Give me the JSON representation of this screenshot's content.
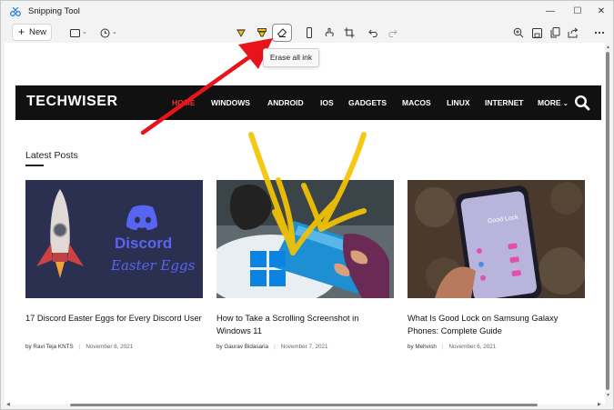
{
  "window": {
    "title": "Snipping Tool",
    "minimize_glyph": "—",
    "maximize_glyph": "☐",
    "close_glyph": "✕"
  },
  "toolbar": {
    "new_label": "New",
    "new_icon": "plus-icon",
    "tooltip": "Erase all ink",
    "icons": [
      "snip-mode-icon",
      "delay-timer-icon",
      "ballpoint-pen-icon",
      "highlighter-icon",
      "eraser-icon",
      "ruler-icon",
      "touch-writing-icon",
      "crop-icon",
      "undo-icon",
      "redo-icon",
      "zoom-in-icon",
      "save-icon",
      "copy-icon",
      "share-icon",
      "more-options-icon"
    ]
  },
  "website": {
    "logo": "TECHWISER",
    "nav": [
      {
        "label": "HOME",
        "active": true
      },
      {
        "label": "WINDOWS",
        "active": false
      },
      {
        "label": "ANDROID",
        "active": false
      },
      {
        "label": "IOS",
        "active": false
      },
      {
        "label": "GADGETS",
        "active": false
      },
      {
        "label": "MACOS",
        "active": false
      },
      {
        "label": "LINUX",
        "active": false
      },
      {
        "label": "INTERNET",
        "active": false
      },
      {
        "label": "MORE",
        "active": false
      }
    ],
    "section_title": "Latest Posts",
    "posts": [
      {
        "title": "17 Discord Easter Eggs for Every Discord User",
        "author": "by Ravi Teja KNTS",
        "date": "November 8, 2021",
        "thumb_title": "Discord",
        "thumb_subtitle": "Easter Eggs"
      },
      {
        "title": "How to Take a Scrolling Screenshot in Windows 11",
        "author": "by Gaurav Bidasaria",
        "date": "November 7, 2021"
      },
      {
        "title": "What Is Good Lock on Samsung Galaxy Phones: Complete Guide",
        "author": "by Mehvish",
        "date": "November 6, 2021",
        "thumb_phone_text": "Good Lock"
      }
    ]
  },
  "colors": {
    "nav_bg": "#111111",
    "nav_active": "#e63a2e",
    "annotation_arrow": "#e8141c",
    "highlighter_ink": "#f5c400",
    "discord_blurple": "#5865f2"
  }
}
